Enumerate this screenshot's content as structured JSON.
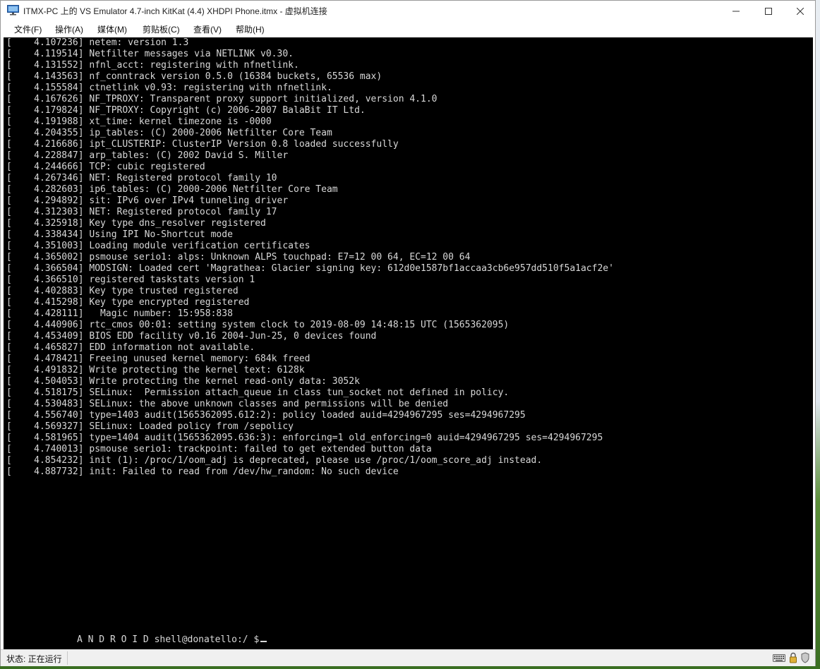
{
  "window": {
    "title": "ITMX-PC 上的 VS Emulator 4.7-inch KitKat (4.4) XHDPI Phone.itmx - 虚拟机连接",
    "app_icon": "monitor-icon",
    "controls": [
      "minimize-icon",
      "maximize-icon",
      "close-icon"
    ]
  },
  "menu": {
    "items": [
      "文件(F)",
      "操作(A)",
      "媒体(M)",
      "剪贴板(C)",
      "查看(V)",
      "帮助(H)"
    ]
  },
  "console": {
    "lines": [
      "[    4.107236] netem: version 1.3",
      "[    4.119514] Netfilter messages via NETLINK v0.30.",
      "[    4.131552] nfnl_acct: registering with nfnetlink.",
      "[    4.143563] nf_conntrack version 0.5.0 (16384 buckets, 65536 max)",
      "[    4.155584] ctnetlink v0.93: registering with nfnetlink.",
      "[    4.167626] NF_TPROXY: Transparent proxy support initialized, version 4.1.0",
      "[    4.179824] NF_TPROXY: Copyright (c) 2006-2007 BalaBit IT Ltd.",
      "[    4.191988] xt_time: kernel timezone is -0000",
      "[    4.204355] ip_tables: (C) 2000-2006 Netfilter Core Team",
      "[    4.216686] ipt_CLUSTERIP: ClusterIP Version 0.8 loaded successfully",
      "[    4.228847] arp_tables: (C) 2002 David S. Miller",
      "[    4.244666] TCP: cubic registered",
      "[    4.267346] NET: Registered protocol family 10",
      "[    4.282603] ip6_tables: (C) 2000-2006 Netfilter Core Team",
      "[    4.294892] sit: IPv6 over IPv4 tunneling driver",
      "[    4.312303] NET: Registered protocol family 17",
      "[    4.325918] Key type dns_resolver registered",
      "[    4.338434] Using IPI No-Shortcut mode",
      "[    4.351003] Loading module verification certificates",
      "[    4.365002] psmouse serio1: alps: Unknown ALPS touchpad: E7=12 00 64, EC=12 00 64",
      "[    4.366504] MODSIGN: Loaded cert 'Magrathea: Glacier signing key: 612d0e1587bf1accaa3cb6e957dd510f5a1acf2e'",
      "[    4.366510] registered taskstats version 1",
      "[    4.402883] Key type trusted registered",
      "[    4.415298] Key type encrypted registered",
      "[    4.428111]   Magic number: 15:958:838",
      "[    4.440906] rtc_cmos 00:01: setting system clock to 2019-08-09 14:48:15 UTC (1565362095)",
      "[    4.453409] BIOS EDD facility v0.16 2004-Jun-25, 0 devices found",
      "[    4.465827] EDD information not available.",
      "[    4.478421] Freeing unused kernel memory: 684k freed",
      "[    4.491832] Write protecting the kernel text: 6128k",
      "[    4.504053] Write protecting the kernel read-only data: 3052k",
      "[    4.518175] SELinux:  Permission attach_queue in class tun_socket not defined in policy.",
      "[    4.530483] SELinux: the above unknown classes and permissions will be denied",
      "[    4.556740] type=1403 audit(1565362095.612:2): policy loaded auid=4294967295 ses=4294967295",
      "[    4.569327] SELinux: Loaded policy from /sepolicy",
      "[    4.581965] type=1404 audit(1565362095.636:3): enforcing=1 old_enforcing=0 auid=4294967295 ses=4294967295",
      "[    4.740013] psmouse serio1: trackpoint: failed to get extended button data",
      "[    4.854232] init (1): /proc/1/oom_adj is deprecated, please use /proc/1/oom_score_adj instead.",
      "[    4.887732] init: Failed to read from /dev/hw_random: No such device"
    ],
    "prompt": "A N D R O I D shell@donatello:/ $"
  },
  "status": {
    "label": "状态: 正在运行",
    "icons": [
      "keyboard-icon",
      "lock-icon",
      "shield-icon"
    ]
  }
}
